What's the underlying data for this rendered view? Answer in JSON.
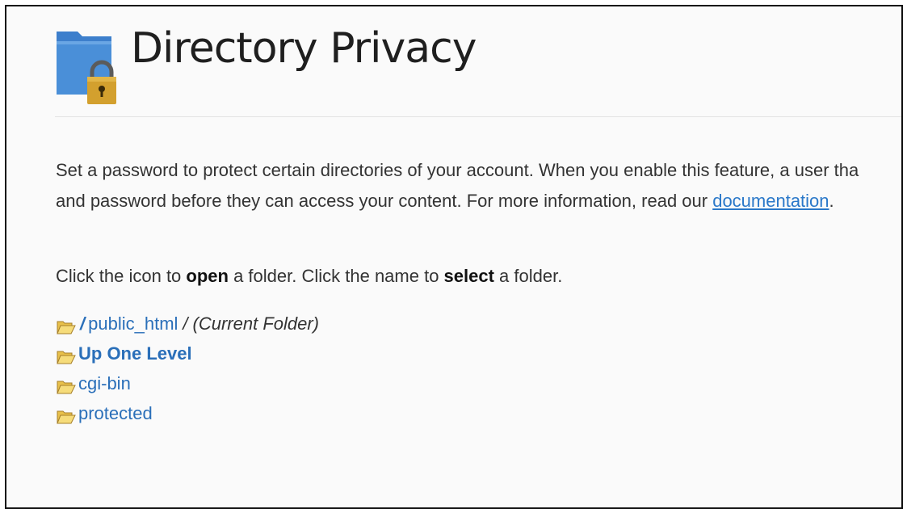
{
  "page": {
    "title": "Directory Privacy",
    "description_line1": "Set a password to protect certain directories of your account. When you enable this feature, a user tha",
    "description_line2_prefix": "and password before they can access your content. For more information, read our ",
    "documentation_link": "documentation",
    "description_line2_suffix": "."
  },
  "instructions": {
    "part1": "Click the icon to ",
    "open": "open",
    "part2": " a folder. Click the name to ",
    "select": "select",
    "part3": " a folder."
  },
  "folders": {
    "current": {
      "root_slash": "/",
      "name": "public_html",
      "separator": "/",
      "label": "(Current Folder)"
    },
    "up": "Up One Level",
    "items": [
      "cgi-bin",
      "protected"
    ]
  },
  "icons": {
    "header": "folder-lock-icon",
    "folder": "open-folder-icon"
  },
  "colors": {
    "link": "#2a6fb9",
    "text": "#333333",
    "folder_blue": "#3d7fcc",
    "lock_gold": "#d3a02e"
  }
}
